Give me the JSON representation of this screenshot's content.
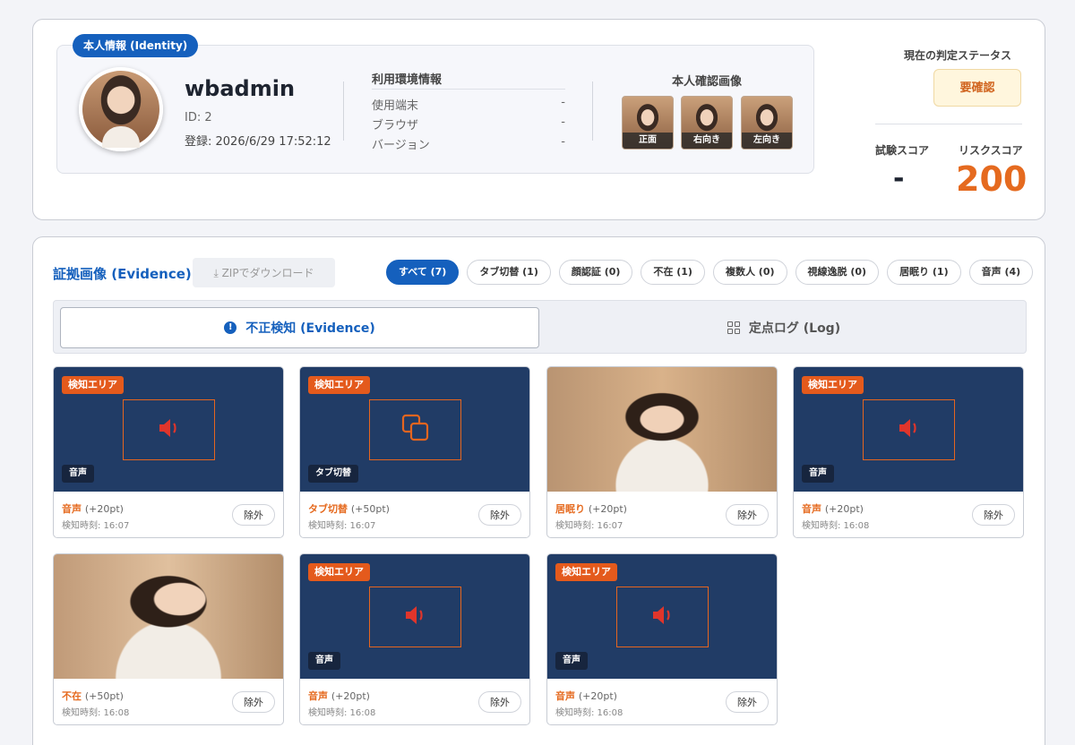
{
  "identity": {
    "badge": "本人情報 (Identity)",
    "username": "wbadmin",
    "id_text": "ID: 2",
    "registered": "登録: 2026/6/29 17:52:12",
    "env": {
      "title": "利用環境情報",
      "rows": [
        {
          "label": "使用端末",
          "value": "-"
        },
        {
          "label": "ブラウザ",
          "value": "-"
        },
        {
          "label": "バージョン",
          "value": "-"
        }
      ]
    },
    "confirm": {
      "title": "本人確認画像",
      "images": [
        "正面",
        "右向き",
        "左向き"
      ]
    }
  },
  "status": {
    "label": "現在の判定ステータス",
    "value": "要確認",
    "exam_label": "試験スコア",
    "exam_value": "-",
    "risk_label": "リスクスコア",
    "risk_value": "200"
  },
  "evidence": {
    "title": "証拠画像 (Evidence)",
    "zip_label": "ZIPでダウンロード",
    "filters": [
      "すべて (7)",
      "タブ切替 (1)",
      "顔認証 (0)",
      "不在 (1)",
      "複数人 (0)",
      "視線逸脱 (0)",
      "居眠り (1)",
      "音声 (4)"
    ],
    "active_filter": 0,
    "tabs": {
      "active": "不正検知 (Evidence)",
      "inactive": "定点ログ (Log)"
    },
    "detect_tag": "検知エリア",
    "exclude_label": "除外",
    "cards": [
      {
        "kind": "audio",
        "type": "音声",
        "name": "音声",
        "pt": "(+20pt)",
        "time": "検知時刻: 16:07"
      },
      {
        "kind": "tab",
        "type": "タブ切替",
        "name": "タブ切替",
        "pt": "(+50pt)",
        "time": "検知時刻: 16:07"
      },
      {
        "kind": "photo-sleep",
        "type": "",
        "name": "居眠り",
        "pt": "(+20pt)",
        "time": "検知時刻: 16:07"
      },
      {
        "kind": "audio",
        "type": "音声",
        "name": "音声",
        "pt": "(+20pt)",
        "time": "検知時刻: 16:08"
      },
      {
        "kind": "photo-cover",
        "type": "",
        "name": "不在",
        "pt": "(+50pt)",
        "time": "検知時刻: 16:08"
      },
      {
        "kind": "audio",
        "type": "音声",
        "name": "音声",
        "pt": "(+20pt)",
        "time": "検知時刻: 16:08"
      },
      {
        "kind": "audio",
        "type": "音声",
        "name": "音声",
        "pt": "(+20pt)",
        "time": "検知時刻: 16:08"
      }
    ]
  },
  "colors": {
    "accent": "#1560bd",
    "alert": "#e56a1f",
    "card_bg": "#213c66"
  }
}
